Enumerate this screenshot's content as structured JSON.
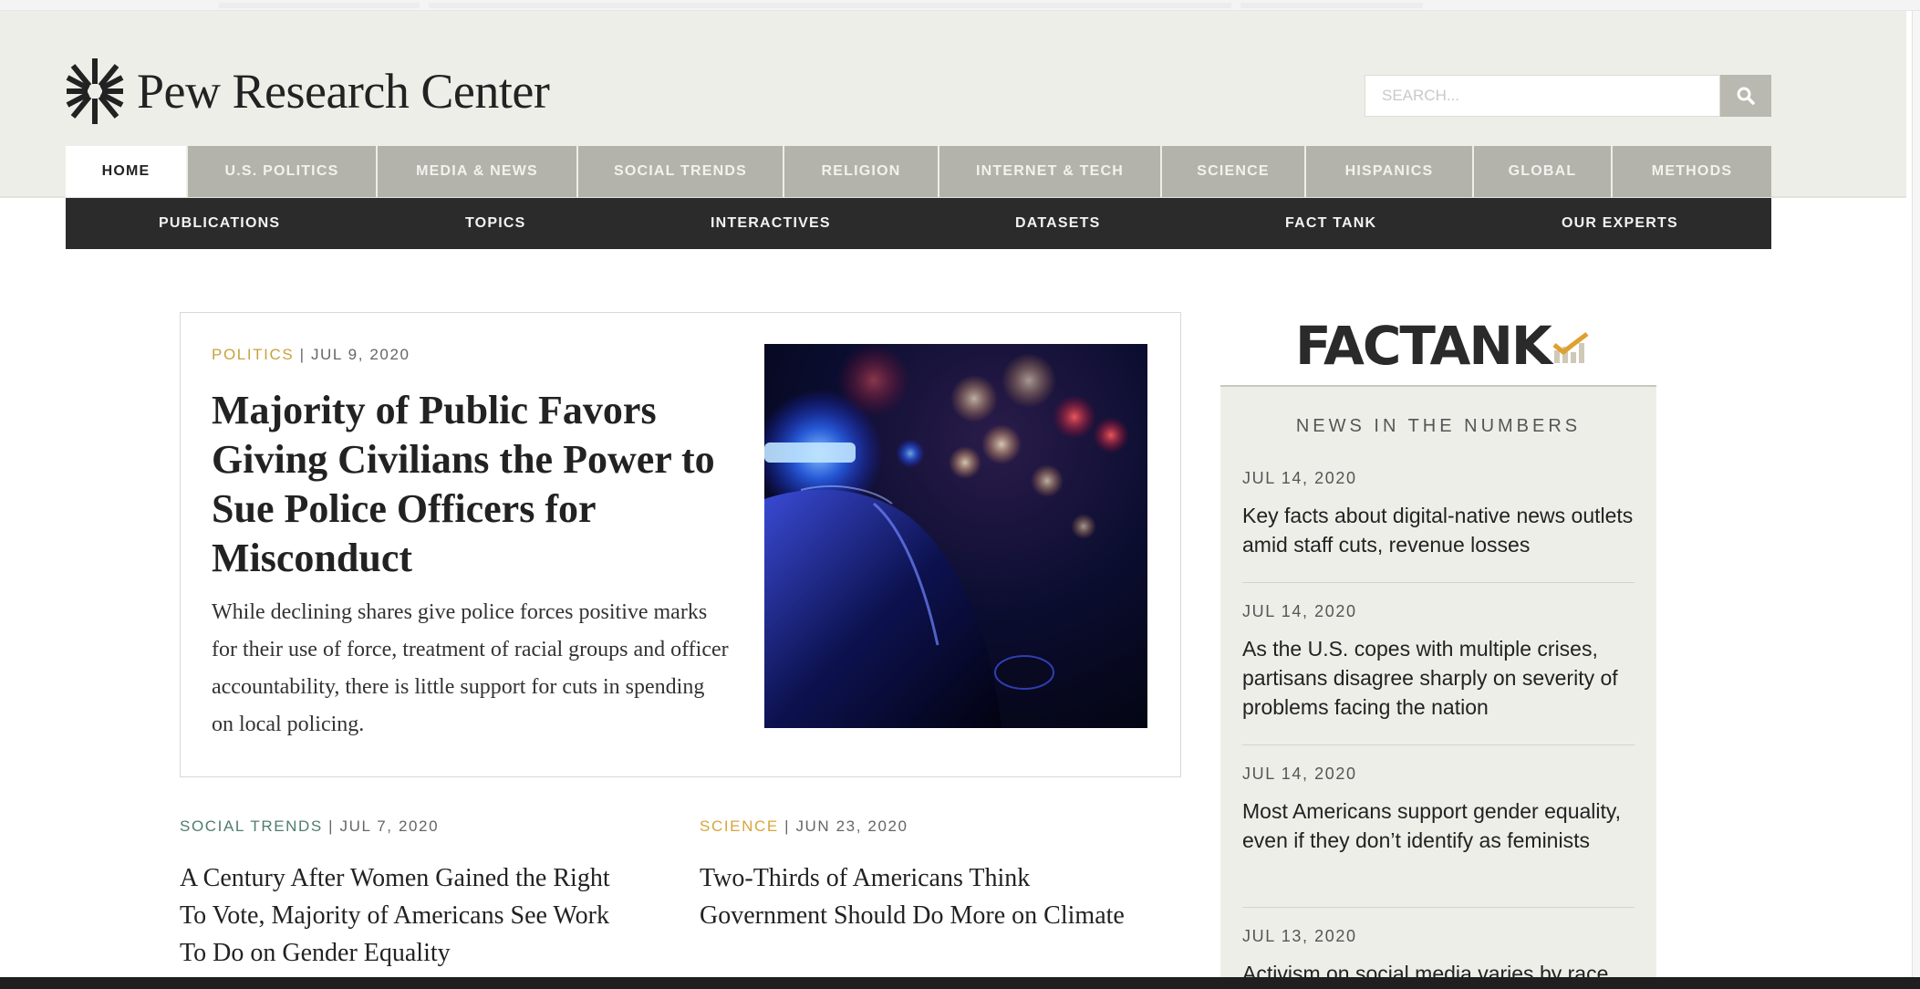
{
  "brand": {
    "name": "Pew Research Center"
  },
  "search": {
    "placeholder": "SEARCH...",
    "icon": "magnifier"
  },
  "primary_nav": [
    {
      "label": "HOME",
      "active": true
    },
    {
      "label": "U.S. POLITICS",
      "active": false
    },
    {
      "label": "MEDIA & NEWS",
      "active": false
    },
    {
      "label": "SOCIAL TRENDS",
      "active": false
    },
    {
      "label": "RELIGION",
      "active": false
    },
    {
      "label": "INTERNET & TECH",
      "active": false
    },
    {
      "label": "SCIENCE",
      "active": false
    },
    {
      "label": "HISPANICS",
      "active": false
    },
    {
      "label": "GLOBAL",
      "active": false
    },
    {
      "label": "METHODS",
      "active": false
    }
  ],
  "secondary_nav": [
    "PUBLICATIONS",
    "TOPICS",
    "INTERACTIVES",
    "DATASETS",
    "FACT TANK",
    "OUR EXPERTS"
  ],
  "feature": {
    "category": "POLITICS",
    "date": "JUL 9, 2020",
    "title": "Majority of Public Favors Giving Civilians the Power to Sue Police Officers for Misconduct",
    "summary": "While declining shares give police forces positive marks for their use of force, treatment of racial groups and officer accountability, there is little support for cuts in spending on local policing."
  },
  "articles": [
    {
      "category": "SOCIAL TRENDS",
      "date": "JUL 7, 2020",
      "title": "A Century After Women Gained the Right To Vote, Majority of Americans See Work To Do on Gender Equality"
    },
    {
      "category": "SCIENCE",
      "date": "JUN 23, 2020",
      "title": "Two-Thirds of Americans Think Government Should Do More on Climate"
    }
  ],
  "fact_tank": {
    "logo_text": "FACTANK",
    "heading": "NEWS IN THE NUMBERS",
    "items": [
      {
        "date": "JUL 14, 2020",
        "title": "Key facts about digital-native news outlets amid staff cuts, revenue losses"
      },
      {
        "date": "JUL 14, 2020",
        "title": "As the U.S. copes with multiple crises, partisans disagree sharply on severity of problems facing the nation"
      },
      {
        "date": "JUL 14, 2020",
        "title": "Most Americans support gender equality, even if they don’t identify as feminists"
      },
      {
        "date": "JUL 13, 2020",
        "title": "Activism on social media varies by race"
      }
    ]
  },
  "colors": {
    "header_bg": "#eeeee9",
    "nav_inactive": "#b3b3ac",
    "secondary_nav_bg": "#2b2b2b",
    "politics": "#c9a23c",
    "social_trends": "#4f7d6c",
    "science": "#d7a53b",
    "factank_accent": "#e0a030"
  }
}
